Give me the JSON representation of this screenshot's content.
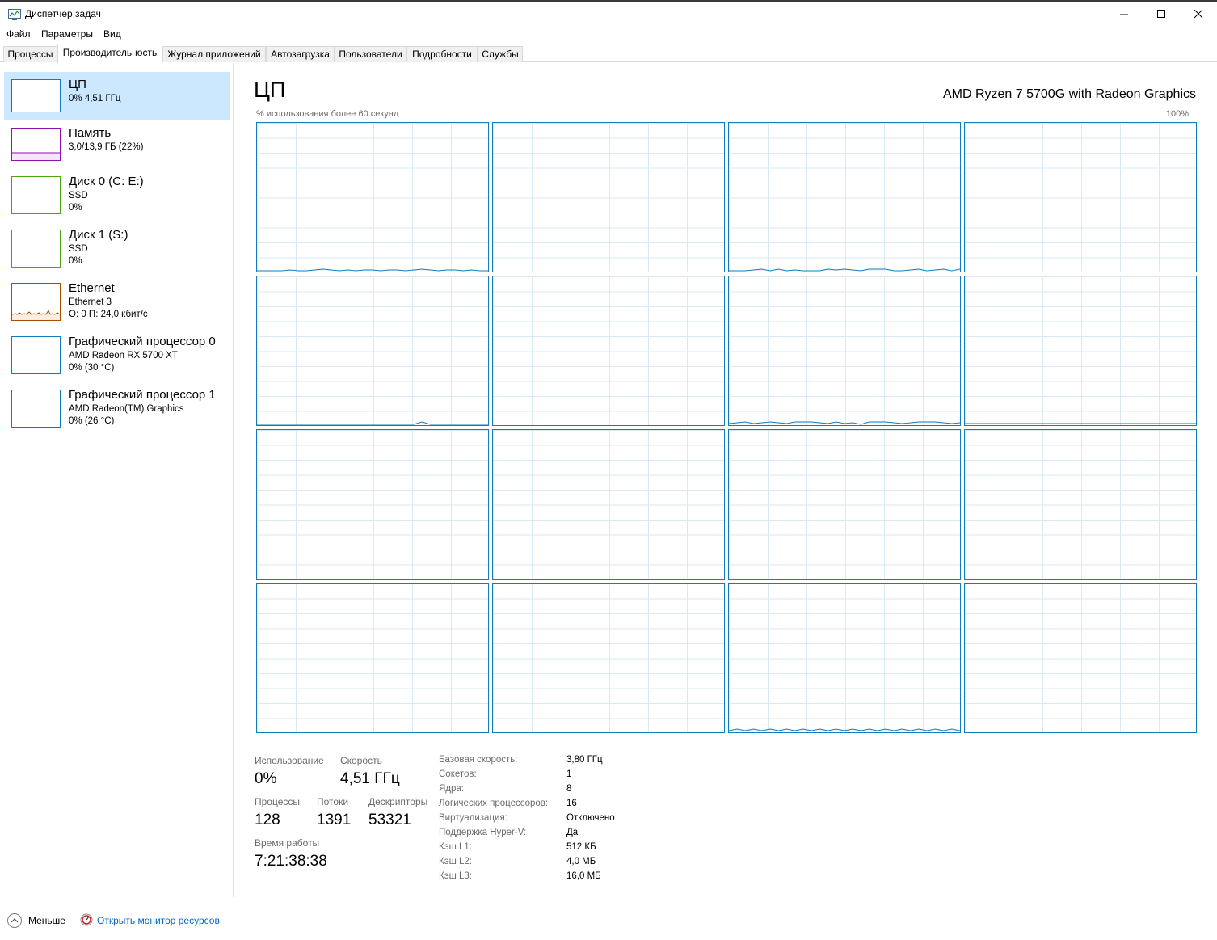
{
  "window": {
    "title": "Диспетчер задач",
    "minimize_glyph": "—",
    "maximize_glyph": "☐",
    "close_glyph": "✕"
  },
  "menu": [
    "Файл",
    "Параметры",
    "Вид"
  ],
  "tabs": [
    "Процессы",
    "Производительность",
    "Журнал приложений",
    "Автозагрузка",
    "Пользователи",
    "Подробности",
    "Службы"
  ],
  "active_tab": "Производительность",
  "sidebar": {
    "items": [
      {
        "title": "ЦП",
        "sub": "0% 4,51 ГГц",
        "sub2": "",
        "color": "#117dbb",
        "active": true
      },
      {
        "title": "Память",
        "sub": "3,0/13,9 ГБ (22%)",
        "sub2": "",
        "color": "#8b12ae",
        "active": false
      },
      {
        "title": "Диск 0 (C: E:)",
        "sub": "SSD",
        "sub2": "0%",
        "color": "#4da60c",
        "active": false
      },
      {
        "title": "Диск 1 (S:)",
        "sub": "SSD",
        "sub2": "0%",
        "color": "#4da60c",
        "active": false
      },
      {
        "title": "Ethernet",
        "sub": "Ethernet 3",
        "sub2": "О: 0 П: 24,0 кбит/с",
        "color": "#a74f01",
        "active": false
      },
      {
        "title": "Графический процессор 0",
        "sub": "AMD Radeon RX 5700 XT",
        "sub2": "0% (30 °C)",
        "color": "#117dbb",
        "active": false
      },
      {
        "title": "Графический процессор 1",
        "sub": "AMD Radeon(TM) Graphics",
        "sub2": "0% (26 °C)",
        "color": "#117dbb",
        "active": false
      }
    ]
  },
  "main": {
    "title": "ЦП",
    "model": "AMD Ryzen 7 5700G with Radeon Graphics",
    "usage_caption": "% использования более 60 секунд",
    "max_label": "100%",
    "graph_color": "#117dbb",
    "core_count": 16
  },
  "stats": {
    "usage_label": "Использование",
    "usage_value": "0%",
    "speed_label": "Скорость",
    "speed_value": "4,51 ГГц",
    "processes_label": "Процессы",
    "processes_value": "128",
    "threads_label": "Потоки",
    "threads_value": "1391",
    "handles_label": "Дескрипторы",
    "handles_value": "53321",
    "uptime_label": "Время работы",
    "uptime_value": "7:21:38:38"
  },
  "info": [
    {
      "label": "Базовая скорость:",
      "value": "3,80 ГГц"
    },
    {
      "label": "Сокетов:",
      "value": "1"
    },
    {
      "label": "Ядра:",
      "value": "8"
    },
    {
      "label": "Логических процессоров:",
      "value": "16"
    },
    {
      "label": "Виртуализация:",
      "value": "Отключено"
    },
    {
      "label": "Поддержка Hyper-V:",
      "value": "Да"
    },
    {
      "label": "Кэш L1:",
      "value": "512 КБ"
    },
    {
      "label": "Кэш L2:",
      "value": "4,0 МБ"
    },
    {
      "label": "Кэш L3:",
      "value": "16,0 МБ"
    }
  ],
  "footer": {
    "less_label": "Меньше",
    "resmon_label": "Открыть монитор ресурсов"
  }
}
